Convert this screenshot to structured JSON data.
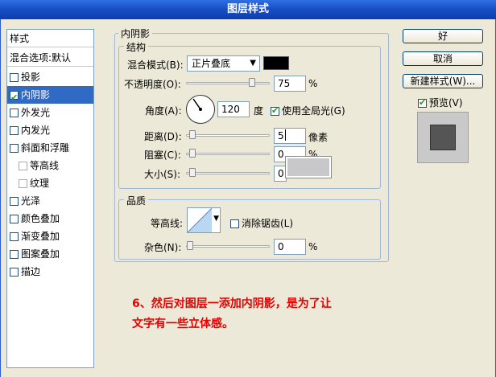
{
  "window": {
    "title": "图层样式"
  },
  "styles_list": {
    "header": "样式",
    "blend_options": "混合选项:默认",
    "items": [
      {
        "label": "投影",
        "checked": false
      },
      {
        "label": "内阴影",
        "checked": true,
        "selected": true
      },
      {
        "label": "外发光",
        "checked": false
      },
      {
        "label": "内发光",
        "checked": false
      },
      {
        "label": "斜面和浮雕",
        "checked": false
      },
      {
        "label": "等高线",
        "checked": false,
        "sub": true
      },
      {
        "label": "纹理",
        "checked": false,
        "sub": true
      },
      {
        "label": "光泽",
        "checked": false
      },
      {
        "label": "颜色叠加",
        "checked": false
      },
      {
        "label": "渐变叠加",
        "checked": false
      },
      {
        "label": "图案叠加",
        "checked": false
      },
      {
        "label": "描边",
        "checked": false
      }
    ]
  },
  "inner_shadow": {
    "title": "内阴影",
    "structure": {
      "title": "结构",
      "blend_mode_label": "混合模式(B):",
      "blend_mode_value": "正片叠底",
      "shadow_color": "#000000",
      "opacity_label": "不透明度(O):",
      "opacity_value": "75",
      "opacity_unit": "%",
      "opacity_level": 0.75,
      "angle_label": "角度(A):",
      "angle_value": "120",
      "angle_unit": "度",
      "global_light_label": "使用全局光(G)",
      "global_light_checked": true,
      "distance_label": "距离(D):",
      "distance_value": "5",
      "distance_unit": "像素",
      "choke_label": "阻塞(C):",
      "choke_value": "0",
      "choke_unit": "%",
      "size_label": "大小(S):",
      "size_value": "0"
    },
    "quality": {
      "title": "品质",
      "contour_label": "等高线:",
      "antialias_label": "消除锯齿(L)",
      "antialias_checked": false,
      "noise_label": "杂色(N):",
      "noise_value": "0",
      "noise_unit": "%"
    }
  },
  "buttons": {
    "ok": "好",
    "cancel": "取消",
    "new_style": "新建样式(W)..."
  },
  "preview": {
    "label": "预览(V)",
    "checked": true
  },
  "note": {
    "line1": "6、然后对图层一添加内阴影，是为了让",
    "line2": "文字有一些立体感。"
  }
}
